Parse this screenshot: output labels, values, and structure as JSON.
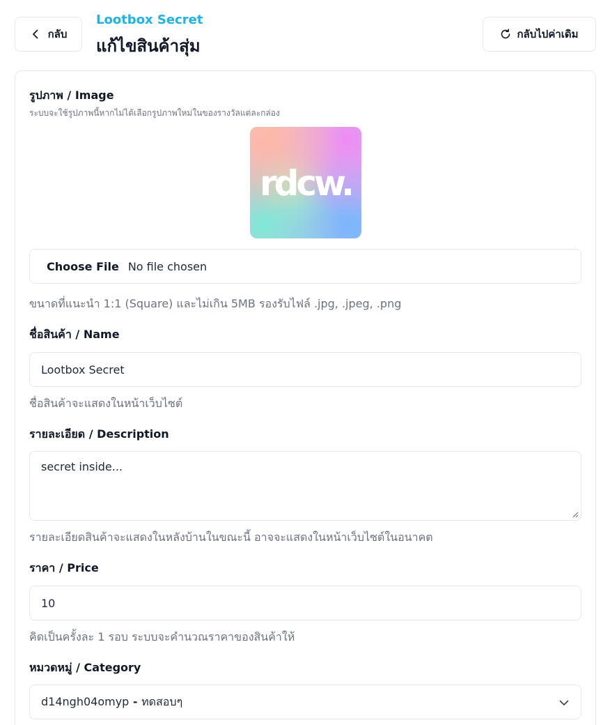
{
  "header": {
    "back_label": "กลับ",
    "subtitle": "Lootbox Secret",
    "title": "แก้ไขสินค้าสุ่ม",
    "reset_label": "กลับไปค่าเดิม"
  },
  "form": {
    "image": {
      "label": "รูปภาพ / Image",
      "sublabel": "ระบบจะใช้รูปภาพนี้หากไม่ได้เลือกรูปภาพใหม่ในของรางวัลแต่ละกล่อง",
      "preview_logo_text": "rdcw.",
      "file_button": "Choose File",
      "file_status": "No file chosen",
      "hint": "ขนาดที่แนะนำ 1:1 (Square) และไม่เกิน 5MB รองรับไฟล์ .jpg, .jpeg, .png"
    },
    "name": {
      "label": "ชื่อสินค้า / Name",
      "value": "Lootbox Secret",
      "hint": "ชื่อสินค้าจะแสดงในหน้าเว็บไซต์"
    },
    "description": {
      "label": "รายละเอียด / Description",
      "value": "secret inside...",
      "hint": "รายละเอียดสินค้าจะแสดงในหลังบ้านในขณะนี้ อาจจะแสดงในหน้าเว็บไซต์ในอนาคต"
    },
    "price": {
      "label": "ราคา / Price",
      "value": "10",
      "hint": "คิดเป็นครั้งละ 1 รอบ ระบบจะคำนวณราคาของสินค้าให้"
    },
    "category": {
      "label": "หมวดหมู่ / Category",
      "selected_id": "d14ngh04omyp",
      "selected_separator": " - ",
      "selected_name": "ทดสอบๆ"
    }
  },
  "icons": {
    "back": "chevron-left-icon",
    "reset": "refresh-icon",
    "select": "chevron-down-icon"
  }
}
